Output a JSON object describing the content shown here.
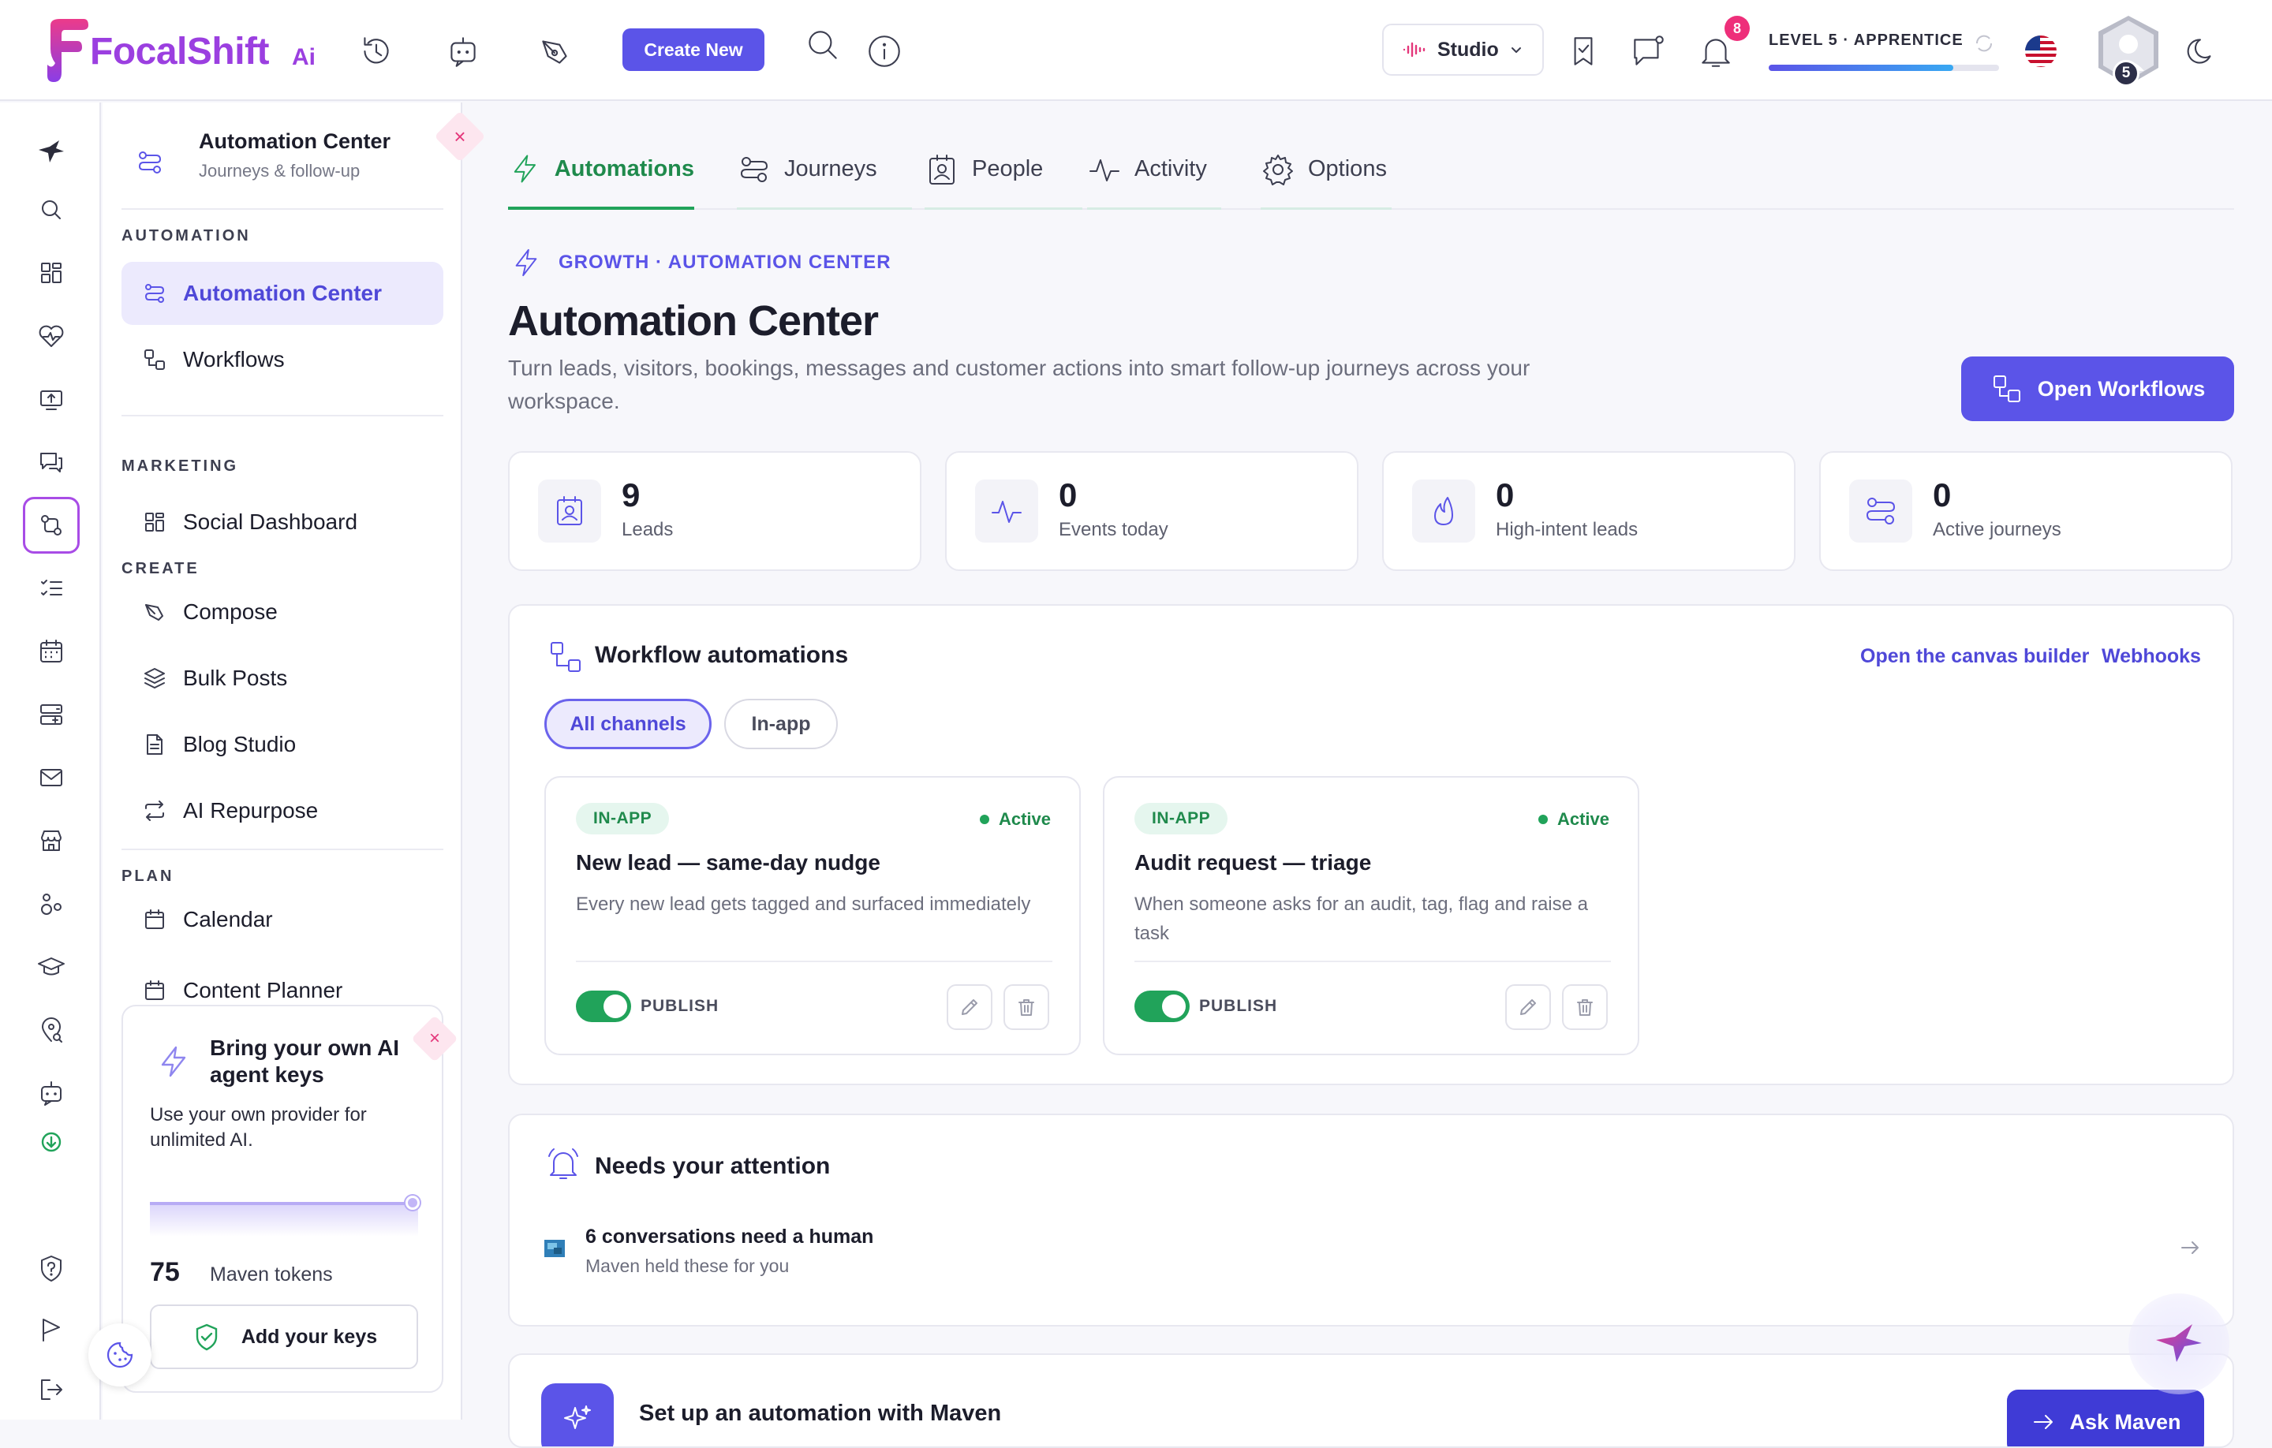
{
  "brand": {
    "name": "FocalShift",
    "suffix": "Ai"
  },
  "header": {
    "create_new": "Create New",
    "workspace": "Studio",
    "notifications_count": "8",
    "level_label": "LEVEL 5 · APPRENTICE",
    "level_progress": 0.8,
    "avatar_level": "5"
  },
  "sidebar": {
    "header": {
      "title": "Automation Center",
      "subtitle": "Journeys & follow-up",
      "close": "×"
    },
    "sections": {
      "automation": "AUTOMATION",
      "marketing": "MARKETING",
      "create": "CREATE",
      "plan": "PLAN"
    },
    "items": {
      "automation_center": "Automation Center",
      "workflows": "Workflows",
      "social_dashboard": "Social Dashboard",
      "compose": "Compose",
      "bulk_posts": "Bulk Posts",
      "blog_studio": "Blog Studio",
      "ai_repurpose": "AI Repurpose",
      "calendar": "Calendar",
      "content_planner": "Content Planner"
    },
    "promo": {
      "title": "Bring your own AI agent keys",
      "description": "Use your own provider for unlimited AI.",
      "tokens_value": "75",
      "tokens_label": "Maven tokens",
      "button": "Add your keys",
      "close": "×"
    }
  },
  "tabs": [
    "Automations",
    "Journeys",
    "People",
    "Activity",
    "Options"
  ],
  "page": {
    "breadcrumb": "GROWTH · AUTOMATION CENTER",
    "title": "Automation Center",
    "description": "Turn leads, visitors, bookings, messages and customer actions into smart follow-up journeys across your workspace.",
    "primary_action": "Open Workflows"
  },
  "stats": [
    {
      "value": "9",
      "label": "Leads",
      "icon": "contact-card-icon"
    },
    {
      "value": "0",
      "label": "Events today",
      "icon": "pulse-icon"
    },
    {
      "value": "0",
      "label": "High-intent leads",
      "icon": "flame-icon"
    },
    {
      "value": "0",
      "label": "Active journeys",
      "icon": "route-icon"
    }
  ],
  "workflows": {
    "title": "Workflow automations",
    "links": {
      "canvas": "Open the canvas builder",
      "webhooks": "Webhooks"
    },
    "filters": [
      "All channels",
      "In-app"
    ],
    "cards": [
      {
        "channel": "IN-APP",
        "status": "Active",
        "name": "New lead — same-day nudge",
        "description": "Every new lead gets tagged and surfaced immediately",
        "publish_label": "PUBLISH",
        "published": true
      },
      {
        "channel": "IN-APP",
        "status": "Active",
        "name": "Audit request — triage",
        "description": "When someone asks for an audit, tag, flag and raise a task",
        "publish_label": "PUBLISH",
        "published": true
      }
    ]
  },
  "attention": {
    "title": "Needs your attention",
    "items": [
      {
        "title": "6 conversations need a human",
        "subtitle": "Maven held these for you"
      }
    ]
  },
  "maven_setup": {
    "title": "Set up an automation with Maven",
    "button": "Ask Maven"
  },
  "colors": {
    "accent": "#5b54e8",
    "brand": "#9b3fe0",
    "success": "#21a35a",
    "alert": "#ee2f7a"
  }
}
